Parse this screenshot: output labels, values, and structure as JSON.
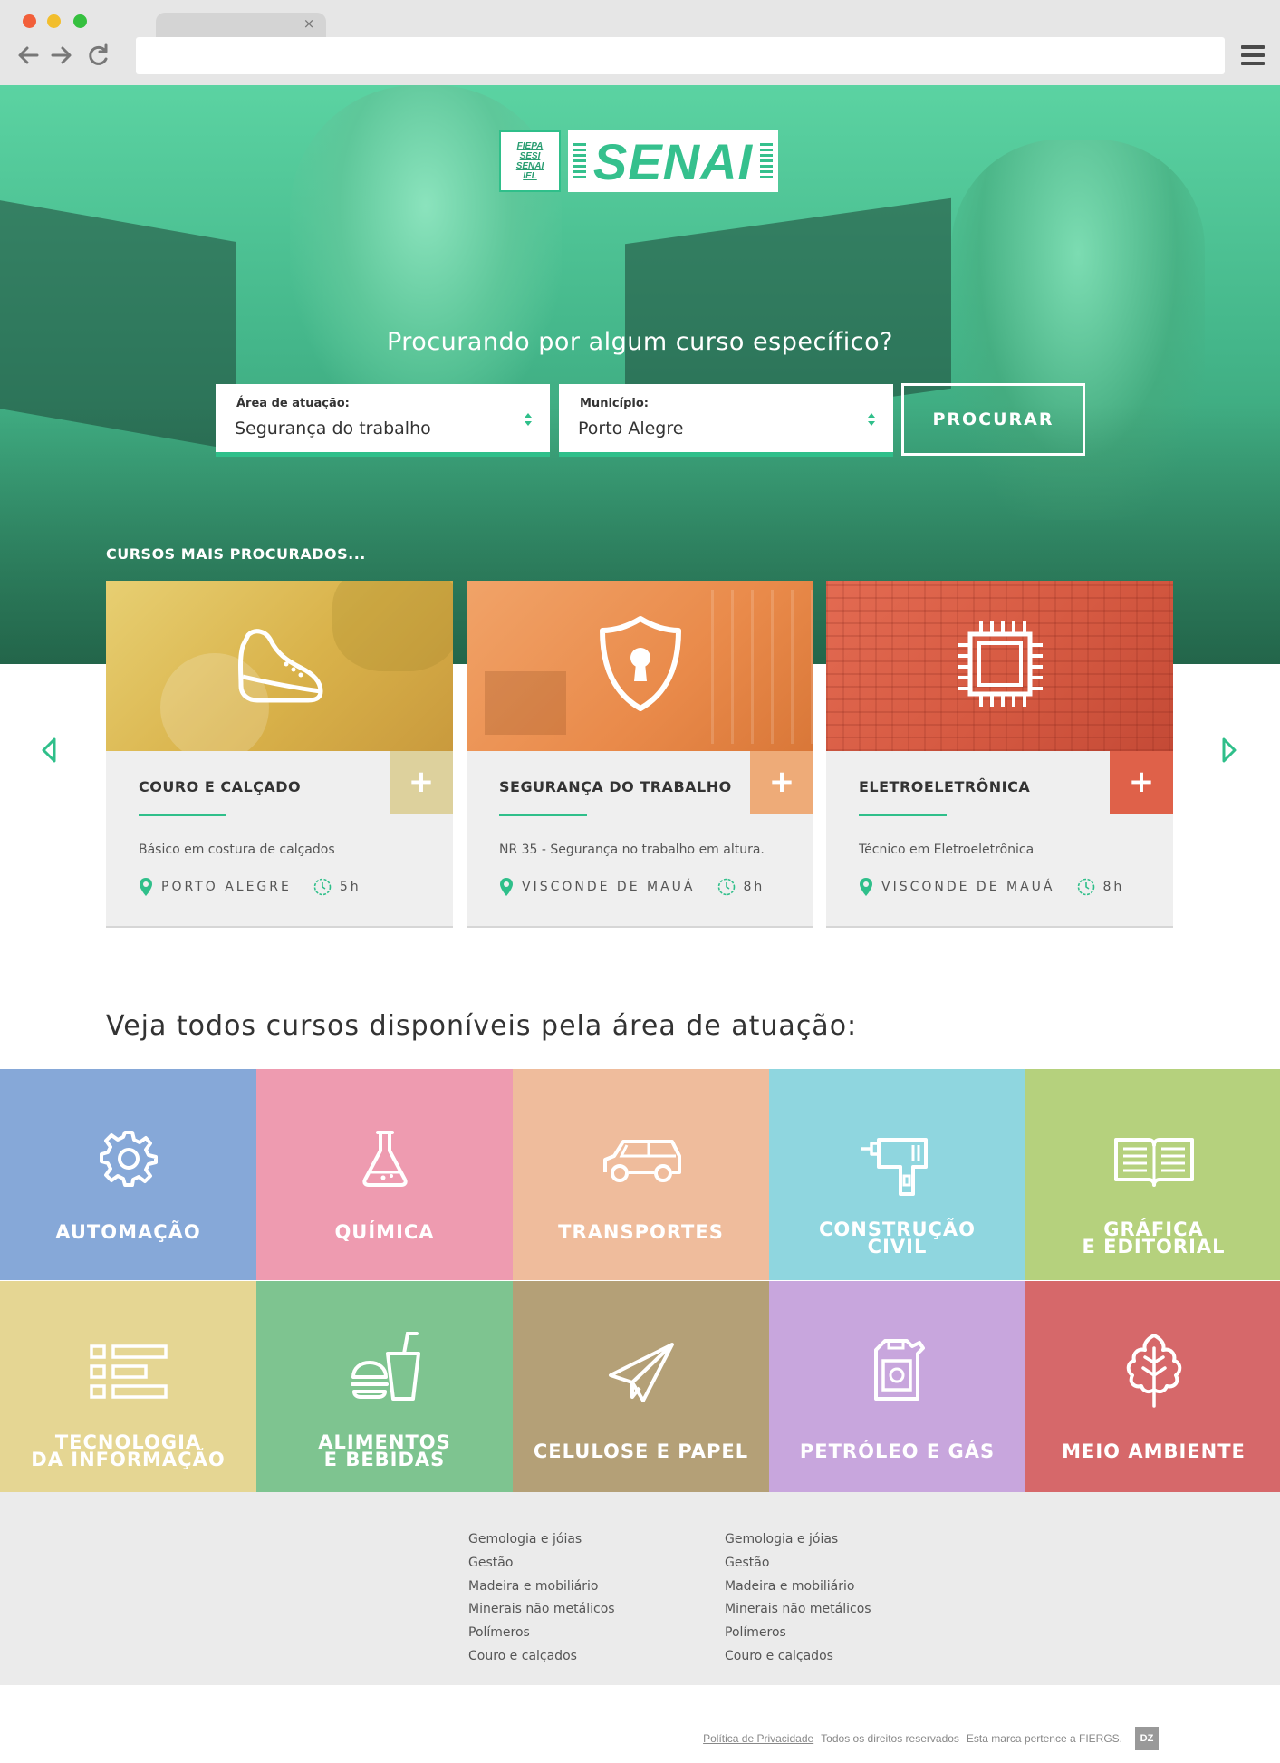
{
  "browser": {
    "address_value": "",
    "tab_close": "×"
  },
  "hero": {
    "logo_small": [
      "FIEPA",
      "SESI",
      "SENAI",
      "IEL"
    ],
    "logo_main": "SENAI",
    "question": "Procurando por algum curso específico?",
    "area_label": "Área de atuação:",
    "area_value": "Segurança do trabalho",
    "city_label": "Município:",
    "city_value": "Porto Alegre",
    "search_button": "PROCURAR",
    "most_searched": "CURSOS MAIS PROCURADOS..."
  },
  "cards": [
    {
      "title": "COURO E CALÇADO",
      "description": "Básico em costura de calçados",
      "city": "PORTO ALEGRE",
      "hours": "5h",
      "plus": "+",
      "icon": "shoe-icon",
      "color": "#e4c86a",
      "plus_color": "#ddd19d"
    },
    {
      "title": "SEGURANÇA DO TRABALHO",
      "description": "NR 35 - Segurança no trabalho em altura.",
      "city": "VISCONDE DE MAUÁ",
      "hours": "8h",
      "plus": "+",
      "icon": "shield-lock-icon",
      "color": "#ee9a5c",
      "plus_color": "#eeab78"
    },
    {
      "title": "ELETROELETRÔNICA",
      "description": "Técnico em Eletroeletrônica",
      "city": "VISCONDE DE MAUÁ",
      "hours": "8h",
      "plus": "+",
      "icon": "chip-icon",
      "color": "#e0654d",
      "plus_color": "#df6149"
    }
  ],
  "categories_heading": "Veja todos cursos disponíveis pela área de atuação:",
  "categories": [
    {
      "label_lines": [
        "AUTOMAÇÃO"
      ],
      "icon": "gear-icon",
      "color": "#86a8d8"
    },
    {
      "label_lines": [
        "QUÍMICA"
      ],
      "icon": "flask-icon",
      "color": "#ee9bb0"
    },
    {
      "label_lines": [
        "TRANSPORTES"
      ],
      "icon": "car-icon",
      "color": "#efbc9c"
    },
    {
      "label_lines": [
        "CONSTRUÇÃO",
        "CIVIL"
      ],
      "icon": "drill-icon",
      "color": "#8fd6df"
    },
    {
      "label_lines": [
        "GRÁFICA",
        "E EDITORIAL"
      ],
      "icon": "book-icon",
      "color": "#b5d17d"
    },
    {
      "label_lines": [
        "TECNOLOGIA",
        "DA INFORMAÇÃO"
      ],
      "icon": "list-icon",
      "color": "#e5d693"
    },
    {
      "label_lines": [
        "ALIMENTOS",
        "E BEBIDAS"
      ],
      "icon": "burger-drink-icon",
      "color": "#7ec490"
    },
    {
      "label_lines": [
        "CELULOSE E PAPEL"
      ],
      "icon": "paper-plane-icon",
      "color": "#b4a077"
    },
    {
      "label_lines": [
        "PETRÓLEO E GÁS"
      ],
      "icon": "jerrycan-icon",
      "color": "#c8a6dd"
    },
    {
      "label_lines": [
        "MEIO AMBIENTE"
      ],
      "icon": "leaf-icon",
      "color": "#d6686a"
    }
  ],
  "footer": {
    "col1": [
      "Gemologia e jóias",
      "Gestão",
      "Madeira e mobiliário",
      "Minerais não metálicos",
      "Polímeros",
      "Couro e calçados"
    ],
    "col2": [
      "Gemologia e jóias",
      "Gestão",
      "Madeira e mobiliário",
      "Minerais não metálicos",
      "Polímeros",
      "Couro e calçados"
    ],
    "privacy": "Política de Privacidade",
    "rights": "Todos os direitos reservados",
    "brand": "Esta marca pertence a FIERGS.",
    "badge": "DZ"
  }
}
